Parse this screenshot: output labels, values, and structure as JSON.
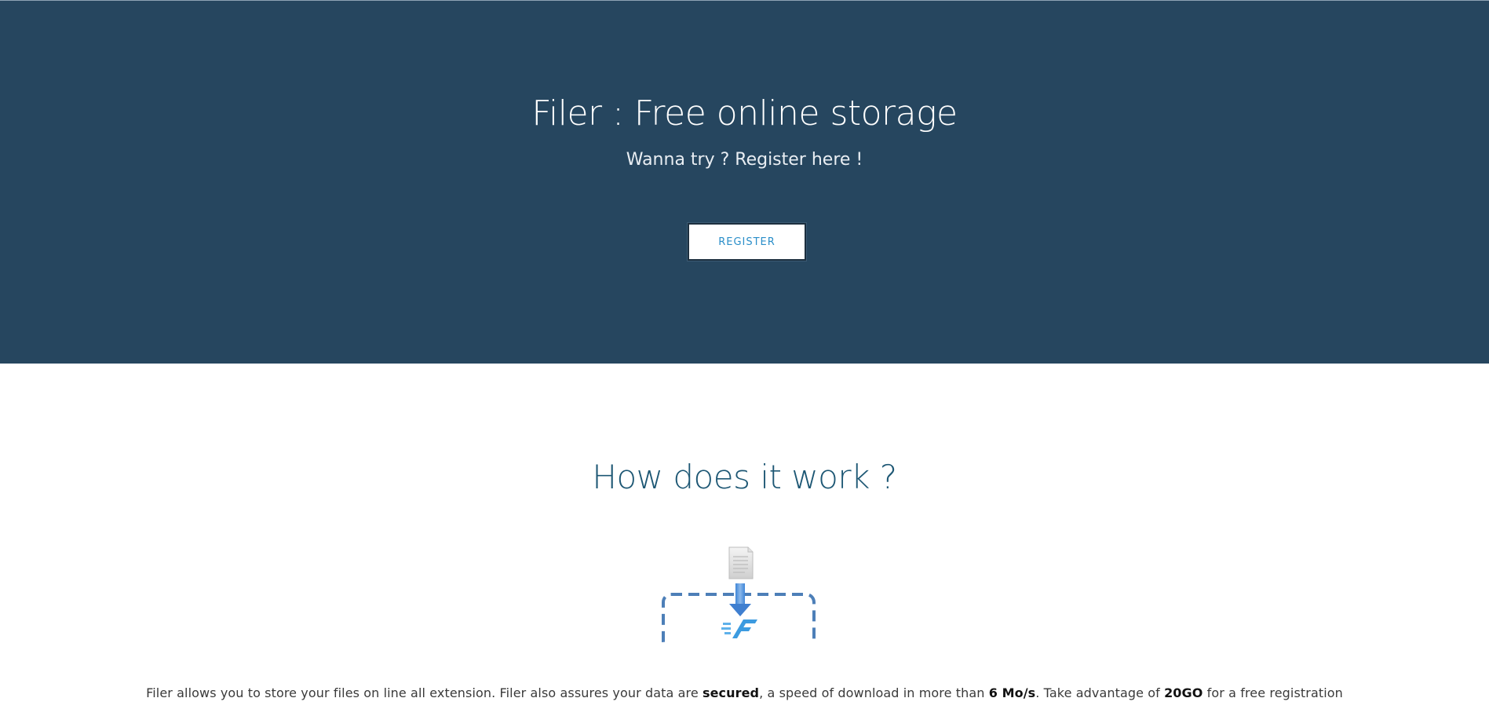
{
  "hero": {
    "title": "Filer : Free online storage",
    "subtitle": "Wanna try ? Register here !",
    "register_label": "REGISTER",
    "background_color": "#26465f"
  },
  "how": {
    "title": "How does it work ?",
    "illustration_icons": [
      "file-icon",
      "download-arrow-icon",
      "filer-logo-icon",
      "dropzone-icon"
    ],
    "description": {
      "part1": "Filer allows you to store your files on line all extension. Filer also assures your data are ",
      "bold1": "secured",
      "part2": ", a speed of download in more than ",
      "bold2": "6 Mo/s",
      "part3": ". Take advantage of ",
      "bold3": "20GO",
      "part4": " for a free registration"
    }
  },
  "colors": {
    "accent": "#2a8ec9",
    "heading": "#1d5774"
  }
}
